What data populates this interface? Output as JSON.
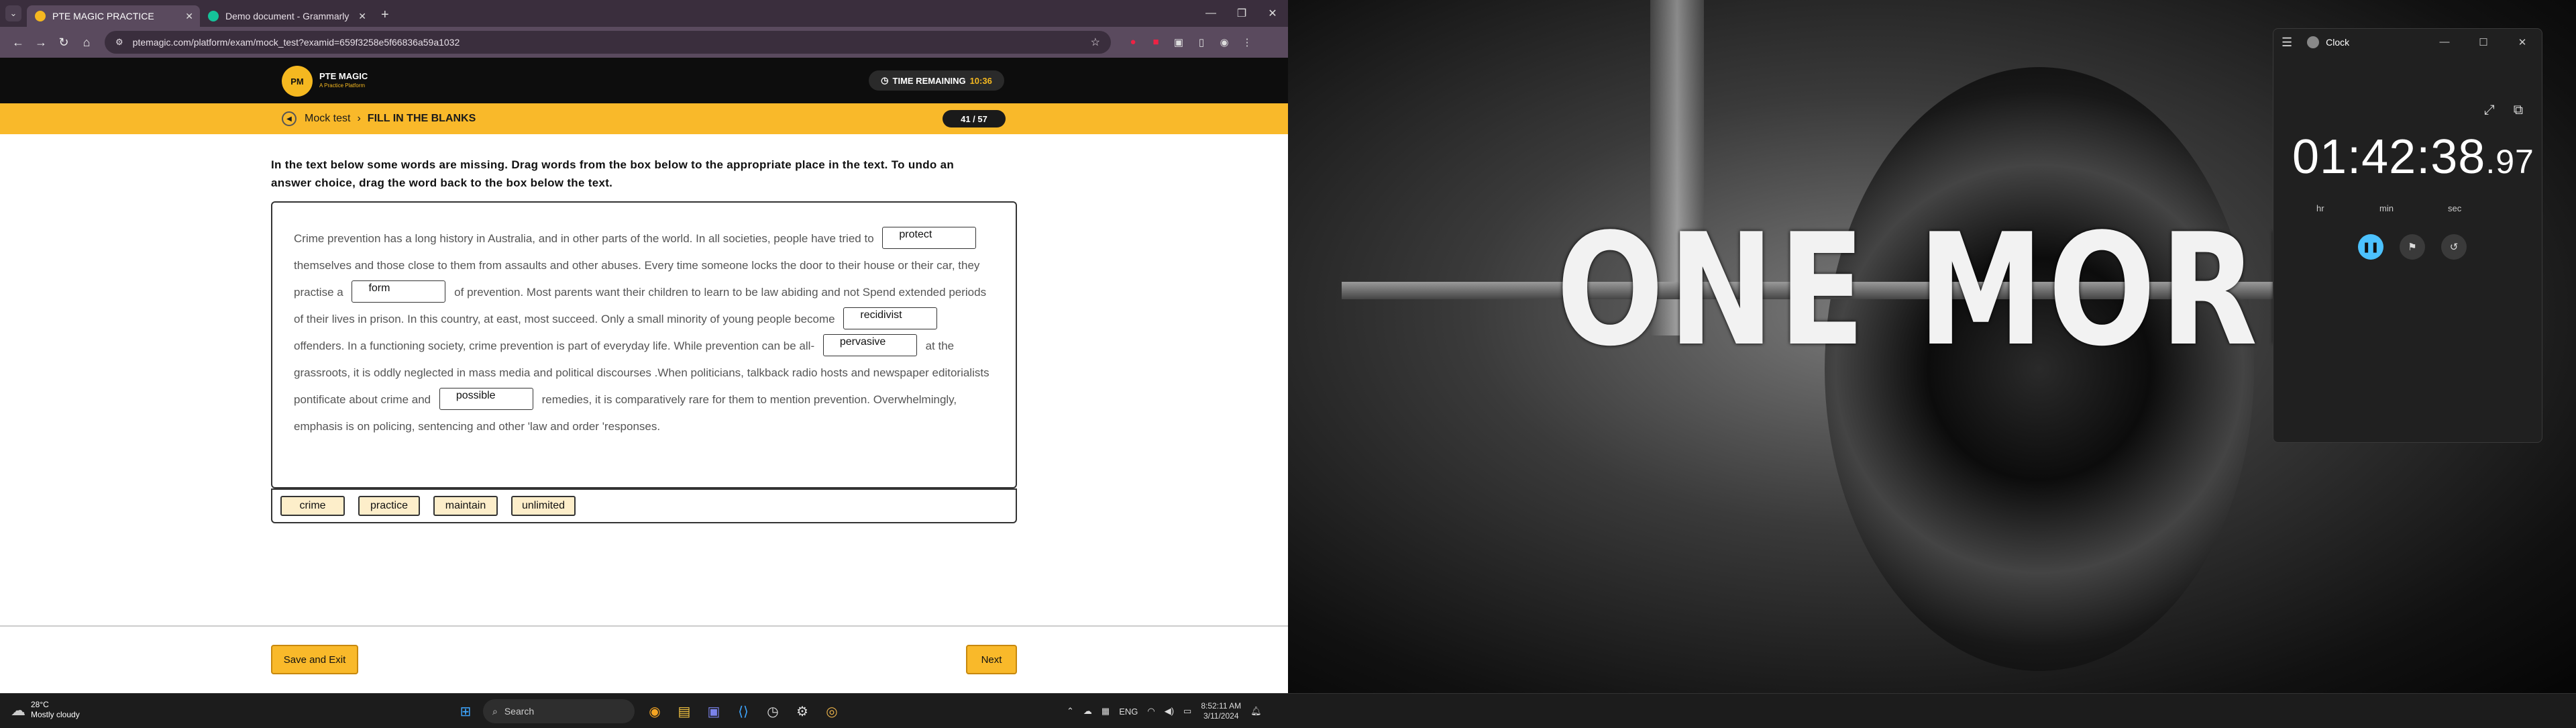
{
  "browser": {
    "tabs": [
      {
        "title": "PTE MAGIC PRACTICE",
        "favicon_color": "#f5b820"
      },
      {
        "title": "Demo document - Grammarly",
        "favicon_color": "#15c39a"
      }
    ],
    "url": "ptemagic.com/platform/exam/mock_test?examid=659f3258e5f66836a59a1032"
  },
  "site": {
    "logo_title": "PTE MAGIC",
    "logo_sub": "A Practice Platform",
    "timer_label": "TIME REMAINING",
    "timer_value": "10:36",
    "breadcrumb_root": "Mock test",
    "breadcrumb_current": "FILL IN THE BLANKS",
    "progress": "41 / 57",
    "instructions": "In the text below some words are missing. Drag words from the box below to the appropriate place in the text. To undo an answer choice, drag the word back to the box below the text.",
    "passage": [
      {
        "type": "text",
        "value": "Crime prevention has a long history in Australia, and in other parts of the world. In all societies, people have tried to"
      },
      {
        "type": "blank",
        "value": "protect"
      },
      {
        "type": "text",
        "value": "themselves and those close to them from assaults and other abuses. Every time someone locks the door to their house or their car, they practise a"
      },
      {
        "type": "blank",
        "value": "form"
      },
      {
        "type": "text",
        "value": "of prevention. Most parents want their children to learn to be law abiding and not Spend extended periods of their lives in prison. In this country, at east, most succeed. Only a small minority of young people become"
      },
      {
        "type": "blank",
        "value": "recidivist"
      },
      {
        "type": "text",
        "value": "offenders. In a functioning society, crime prevention is part of everyday life. While prevention can be all-"
      },
      {
        "type": "blank",
        "value": "pervasive"
      },
      {
        "type": "text",
        "value": "at the grassroots, it is oddly neglected in mass media and political discourses .When politicians, talkback radio hosts and newspaper editorialists pontificate about crime and"
      },
      {
        "type": "blank",
        "value": "possible"
      },
      {
        "type": "text",
        "value": "remedies, it is comparatively rare for them to mention prevention. Overwhelmingly, emphasis is on policing, sentencing and other 'law and order 'responses."
      }
    ],
    "word_bank": [
      "crime",
      "practice",
      "maintain",
      "unlimited"
    ],
    "save_exit_label": "Save and Exit",
    "next_label": "Next"
  },
  "wallpaper": {
    "text": "ONE MORE"
  },
  "clock_app": {
    "title": "Clock",
    "hours": "01",
    "minutes": "42",
    "seconds": "38",
    "hundredths": "97",
    "unit_hr": "hr",
    "unit_min": "min",
    "unit_sec": "sec"
  },
  "taskbar": {
    "temp": "28°C",
    "weather": "Mostly cloudy",
    "search_placeholder": "Search",
    "lang": "ENG",
    "time": "8:52:11 AM",
    "date": "3/11/2024"
  }
}
